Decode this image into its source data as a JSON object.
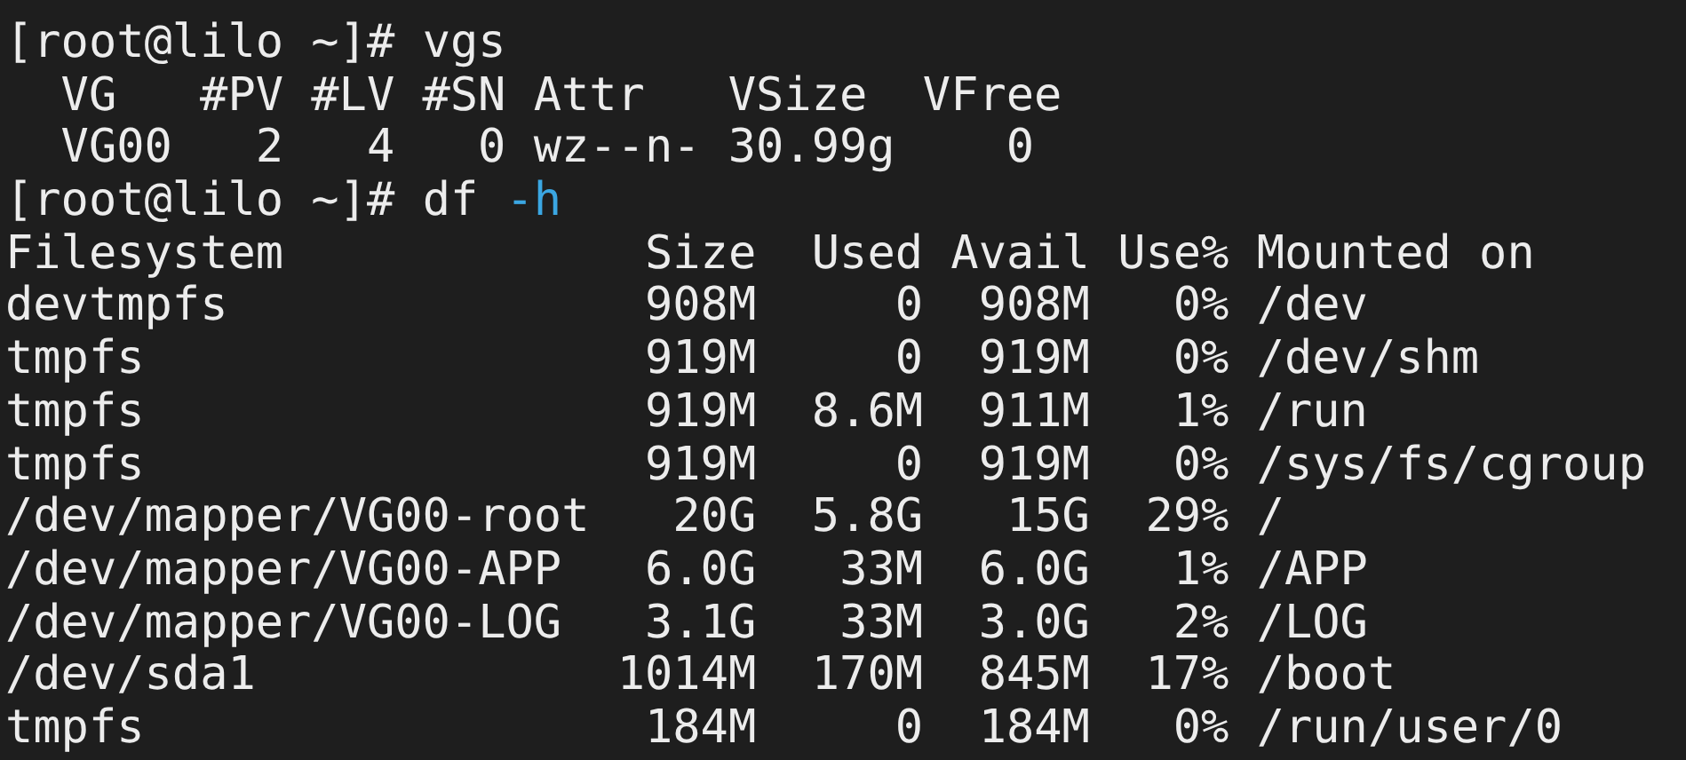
{
  "terminal": {
    "lines": [
      {
        "kind": "command",
        "prompt": "[root@lilo ~]#",
        "command": "vgs"
      },
      {
        "kind": "vgs_table",
        "columns": [
          "VG",
          "#PV",
          "#LV",
          "#SN",
          "Attr",
          "VSize",
          "VFree"
        ],
        "rows": [
          [
            "VG00",
            "2",
            "4",
            "0",
            "wz--n-",
            "30.99g",
            "0"
          ]
        ]
      },
      {
        "kind": "command",
        "prompt": "[root@lilo ~]#",
        "command": "df",
        "option": "-h"
      },
      {
        "kind": "df_table",
        "columns": [
          "Filesystem",
          "Size",
          "Used",
          "Avail",
          "Use%",
          "Mounted on"
        ],
        "rows": [
          [
            "devtmpfs",
            "908M",
            "0",
            "908M",
            "0%",
            "/dev"
          ],
          [
            "tmpfs",
            "919M",
            "0",
            "919M",
            "0%",
            "/dev/shm"
          ],
          [
            "tmpfs",
            "919M",
            "8.6M",
            "911M",
            "1%",
            "/run"
          ],
          [
            "tmpfs",
            "919M",
            "0",
            "919M",
            "0%",
            "/sys/fs/cgroup"
          ],
          [
            "/dev/mapper/VG00-root",
            "20G",
            "5.8G",
            "15G",
            "29%",
            "/"
          ],
          [
            "/dev/mapper/VG00-APP",
            "6.0G",
            "33M",
            "6.0G",
            "1%",
            "/APP"
          ],
          [
            "/dev/mapper/VG00-LOG",
            "3.1G",
            "33M",
            "3.0G",
            "2%",
            "/LOG"
          ],
          [
            "/dev/sda1",
            "1014M",
            "170M",
            "845M",
            "17%",
            "/boot"
          ],
          [
            "tmpfs",
            "184M",
            "0",
            "184M",
            "0%",
            "/run/user/0"
          ]
        ]
      }
    ]
  }
}
